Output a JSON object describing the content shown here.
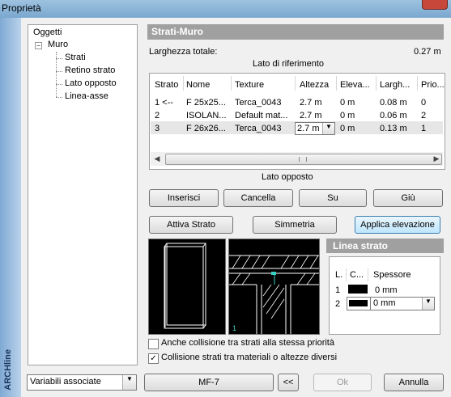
{
  "window": {
    "title": "Proprietà",
    "brand": "ARCHline"
  },
  "tree": {
    "root": "Oggetti",
    "parent": "Muro",
    "children": [
      "Strati",
      "Retino strato",
      "Lato opposto",
      "Linea-asse"
    ]
  },
  "panel": {
    "title": "Strati-Muro",
    "width_label": "Larghezza totale:",
    "width_value": "0.27 m",
    "ref_side": "Lato di riferimento",
    "opposite_side": "Lato opposto"
  },
  "table": {
    "columns": [
      "Strato",
      "Nome",
      "Texture",
      "Altezza",
      "Eleva...",
      "Largh...",
      "Prio..."
    ],
    "rows": [
      [
        "1 <--",
        "F 25x25...",
        "Terca_0043",
        "2.7 m",
        "0 m",
        "0.08 m",
        "0"
      ],
      [
        "2",
        "ISOLAN...",
        "Default mat...",
        "2.7 m",
        "0 m",
        "0.06 m",
        "2"
      ],
      [
        "3",
        "F 26x26...",
        "Terca_0043",
        "2.7 m",
        "0 m",
        "0.13 m",
        "1"
      ]
    ]
  },
  "buttons": {
    "insert": "Inserisci",
    "delete": "Cancella",
    "up": "Su",
    "down": "Giù",
    "activate": "Attiva Strato",
    "symmetry": "Simmetria",
    "apply_elevation": "Applica elevazione",
    "mf7": "MF-7",
    "back": "<<",
    "ok": "Ok",
    "cancel": "Annulla"
  },
  "line_strato": {
    "title": "Linea strato",
    "columns": [
      "L.",
      "C...",
      "Spessore"
    ],
    "rows": [
      {
        "l": "1",
        "spessore": "0 mm"
      },
      {
        "l": "2",
        "spessore": "0 mm"
      }
    ]
  },
  "checks": {
    "c1": {
      "label": "Anche collisione tra strati alla stessa priorità",
      "checked": false
    },
    "c2": {
      "label": "Collisione strati tra materiali o altezze diversi",
      "checked": true
    }
  },
  "footer": {
    "select": "Variabili associate"
  }
}
